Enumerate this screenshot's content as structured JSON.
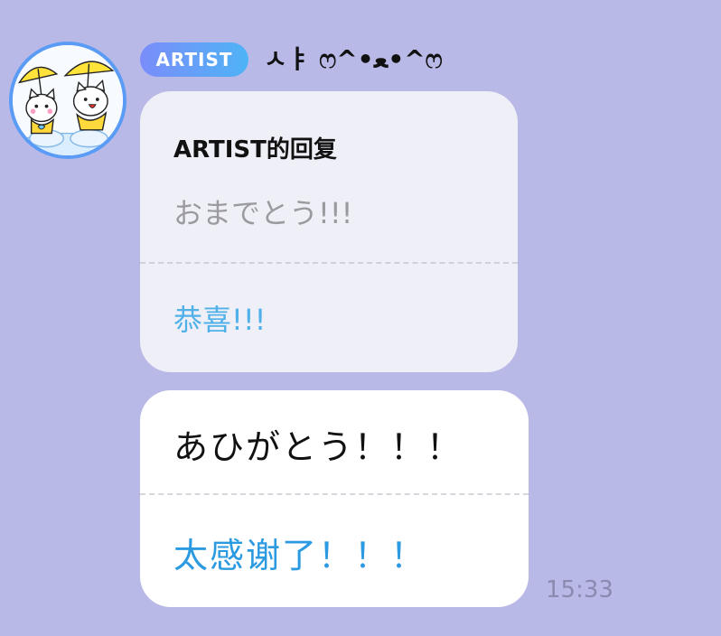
{
  "sender": {
    "badge": "ARTIST",
    "name": "ㅅㅑ ෆ^•ﻌ•^ෆ"
  },
  "reply": {
    "title": "ARTIST的回复",
    "original": "おまでとう!!!",
    "translation": "恭喜!!!"
  },
  "message": {
    "original": "あひがとう！！！",
    "translation": "太感谢了！！！",
    "time": "15:33"
  },
  "colors": {
    "background": "#b9b9e8",
    "badge_start": "#7a8dfb",
    "badge_end": "#4fb3f6",
    "translation_blue": "#2b9ae0",
    "avatar_ring": "#5a9cf5"
  },
  "icons": {
    "avatar": "cartoon-cats-with-yellow-umbrellas"
  }
}
